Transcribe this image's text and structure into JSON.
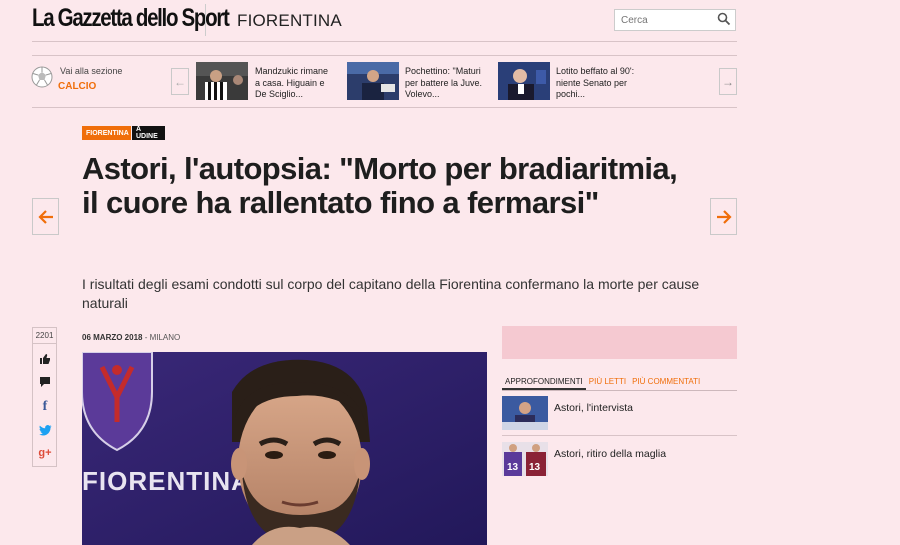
{
  "header": {
    "logo": "La Gazzetta dello Sport",
    "section": "FIORENTINA",
    "search_placeholder": "Cerca"
  },
  "strip": {
    "section_prompt": "Vai alla sezione",
    "section_link": "CALCIO",
    "teasers": [
      {
        "text": "Mandzukic rimane a casa. Higuain e De Sciglio..."
      },
      {
        "text": "Pochettino: \"Maturi per battere la Juve. Volevo..."
      },
      {
        "text": "Lotito beffato al 90': niente Senato per pochi..."
      }
    ]
  },
  "article": {
    "tags": [
      "FIORENTINA",
      "A UDINE"
    ],
    "title": "Astori, l'autopsia: \"Morto per bradiaritmia, il cuore ha rallentato fino a fermarsi\"",
    "subtitle": "I risultati degli esami condotti sul corpo del capitano della Fiorentina confermano la morte per cause naturali",
    "date": "06 MARZO 2018",
    "location": "MILANO",
    "photo_caption_text": "FIORENTINA"
  },
  "share": {
    "count": "2201",
    "icons": [
      "thumbs-up-icon",
      "comment-icon",
      "facebook-icon",
      "twitter-icon",
      "googleplus-icon"
    ]
  },
  "sidebar": {
    "tabs": [
      "APPROFONDIMENTI",
      "PIÙ LETTI",
      "PIÙ COMMENTATI"
    ],
    "items": [
      {
        "title": "Astori, l'intervista"
      },
      {
        "title": "Astori, ritiro della maglia"
      }
    ]
  },
  "colors": {
    "background": "#fce8ec",
    "accent": "#f06e0a",
    "fiorentina_purple": "#4b2a82"
  }
}
